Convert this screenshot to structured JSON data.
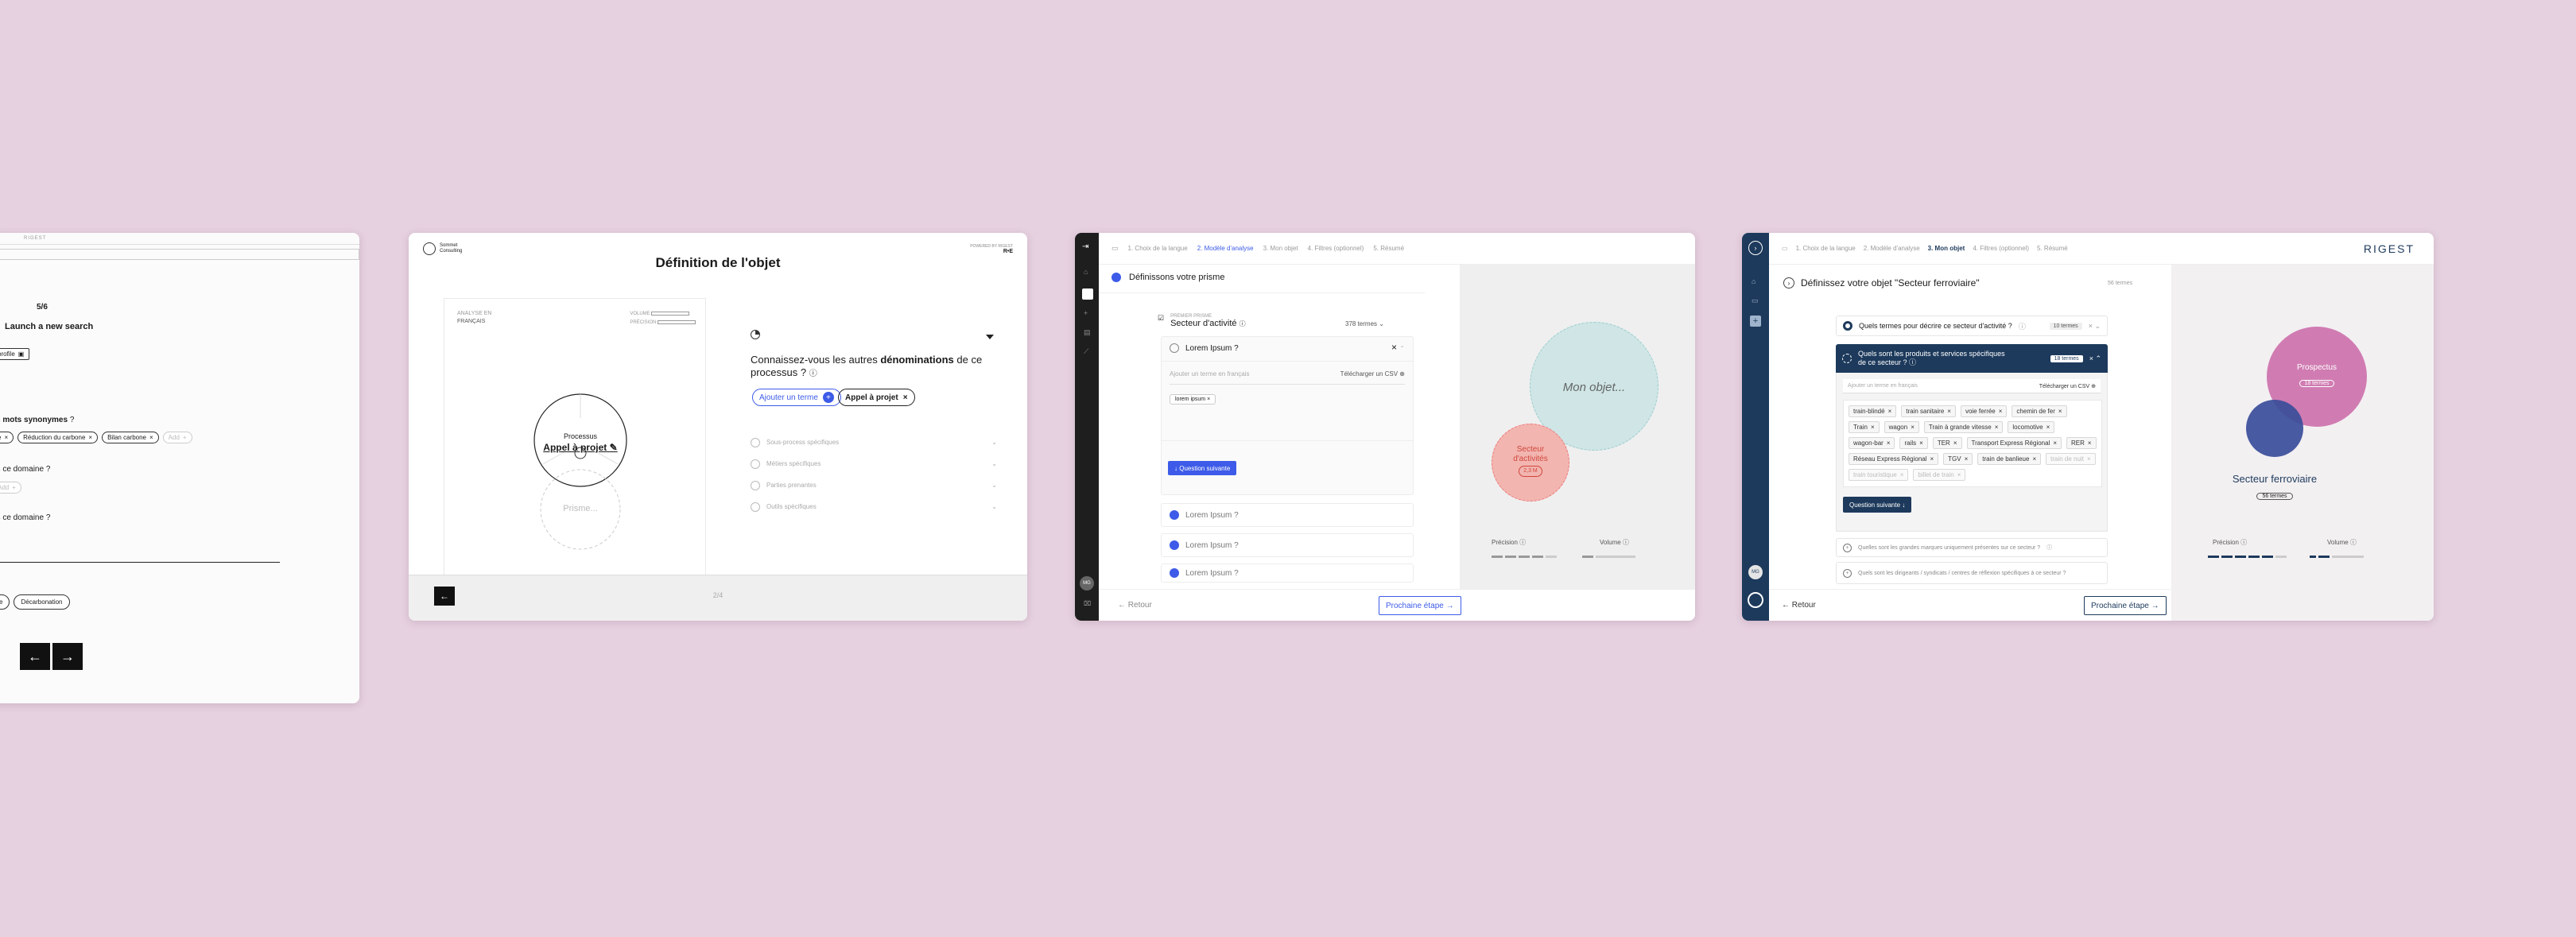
{
  "card1": {
    "brand": "RIGEST",
    "step": "5/6",
    "heading": "Launch a new search",
    "profile_chip": "profile",
    "q1": "es mots synonymes ?",
    "q1_bold": "mots synonymes",
    "chips": [
      "e",
      "Réduction du carbone",
      "Bilan carbone"
    ],
    "add_chip": "Add",
    "q2": "ns ce domaine ?",
    "q2_chip": "Add",
    "q3": "ns ce domaine ?",
    "bottom_chips": [
      "e",
      "Décarbonation"
    ],
    "prev": "←",
    "next": "→"
  },
  "card2": {
    "logo_name": "Sommet Consulting",
    "powered_label": "POWERED BY RIGEST",
    "powered_brand": "R•E",
    "title": "Définition de l'objet",
    "analysis_label": "ANALYSE EN",
    "analysis_lang": "FRANÇAIS",
    "volume_label": "VOLUME",
    "precision_label": "PRÉCISION",
    "process_label": "Processus",
    "process_value": "Appel à projet",
    "prism_label": "Prisme...",
    "question_prefix": "Connaissez-vous les autres ",
    "question_bold": "dénominations",
    "question_suffix": " de ce processus ?",
    "add_term": "Ajouter un terme",
    "term_chip": "Appel à projet",
    "options": [
      "Sous-process spécifiques",
      "Métiers spécifiques",
      "Parties prenantes",
      "Outils spécifiques"
    ],
    "page": "2/4",
    "back_arrow": "←"
  },
  "card3": {
    "steps": [
      "1. Choix de la langue",
      "2. Modèle d'analyse",
      "3. Mon objet",
      "4. Filtres (optionnel)",
      "5. Résumé"
    ],
    "active_step": 1,
    "section_title": "Définissons votre prisme",
    "prism_kicker": "PREMIER PRISME",
    "prism_name": "Secteur d'activité",
    "terms_count": "378 termes",
    "q_open": "Lorem Ipsum ?",
    "input_placeholder": "Ajouter un terme en français",
    "csv": "Télécharger un CSV",
    "chip": "lorem ipsum",
    "next_q": "Question suivante",
    "questions": [
      "Lorem Ipsum ?",
      "Lorem Ipsum ?",
      "Lorem Ipsum ?"
    ],
    "circle_big": "Mon objet...",
    "circle_small_1": "Secteur",
    "circle_small_2": "d'activités",
    "circle_small_count": "2,3 M",
    "precision": "Précision",
    "volume": "Volume",
    "back": "Retour",
    "next": "Prochaine étape",
    "avatar": "MG"
  },
  "card4": {
    "steps": [
      "1. Choix de la langue",
      "2. Modèle d'analyse",
      "3. Mon objet",
      "4. Filtres (optionnel)",
      "5. Résumé"
    ],
    "active_step": 2,
    "brand": "RIGEST",
    "title": "Définissez votre objet \"Secteur ferroviaire\"",
    "title_count": "56 termes",
    "q1": "Quels termes pour décrire ce secteur d'activité ?",
    "q1_badge": "10 termes",
    "q2_line1": "Quels sont les produits et services spécifiques",
    "q2_line2": "de ce secteur ?",
    "q2_badge": "18 termes",
    "input_placeholder": "Ajouter un terme en français",
    "csv": "Télécharger un CSV",
    "tags": [
      "train-blindé",
      "train sanitaire",
      "voie ferrée",
      "chemin de fer",
      "Train",
      "wagon",
      "Train à grande vitesse",
      "locomotive",
      "wagon-bar",
      "rails",
      "TER",
      "Transport Express Régional",
      "RER",
      "Réseau Express Régional",
      "TGV",
      "train de banlieue"
    ],
    "faded_tags": [
      "train de nuit",
      "train touristique",
      "billet de train"
    ],
    "next_q": "Question suivante",
    "q3": "Quelles sont les grandes marques uniquement présentes sur ce secteur ?",
    "q4": "Quels sont les dirigeants / syndicats / centres de réflexion spécifiques à ce secteur ?",
    "circle_label": "Prospectus",
    "circle_count": "18 termes",
    "sector_name": "Secteur ferroviaire",
    "sector_count": "56 termes",
    "precision": "Précision",
    "volume": "Volume",
    "back": "Retour",
    "next": "Prochaine étape",
    "avatar": "MG"
  }
}
